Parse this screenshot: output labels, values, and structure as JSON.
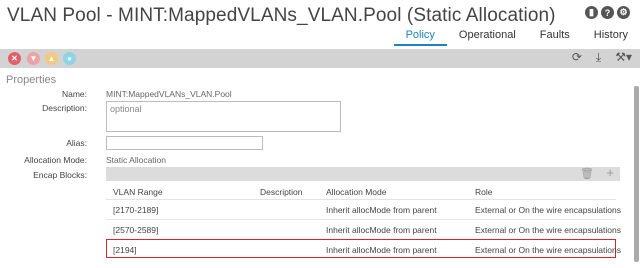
{
  "header": {
    "title": "VLAN Pool - MINT:MappedVLANs_VLAN.Pool (Static Allocation)",
    "icons": [
      "bookmark-icon",
      "help-icon",
      "settings-icon"
    ]
  },
  "tabs": [
    {
      "label": "Policy",
      "active": true
    },
    {
      "label": "Operational",
      "active": false
    },
    {
      "label": "Faults",
      "active": false
    },
    {
      "label": "History",
      "active": false
    }
  ],
  "toolbar": {
    "fault_dots": [
      {
        "icon": "critical-fault-icon",
        "color": "#e2606a"
      },
      {
        "icon": "major-fault-icon",
        "color": "#eda2a7"
      },
      {
        "icon": "minor-fault-icon",
        "color": "#f2c980"
      },
      {
        "icon": "warning-fault-icon",
        "color": "#8ed3e8"
      }
    ],
    "actions": [
      "refresh-icon",
      "download-icon",
      "tools-icon"
    ]
  },
  "properties": {
    "section_title": "Properties",
    "name_label": "Name:",
    "name_value": "MINT:MappedVLANs_VLAN.Pool",
    "description_label": "Description:",
    "description_placeholder": "optional",
    "alias_label": "Alias:",
    "alias_value": "",
    "allocation_label": "Allocation Mode:",
    "allocation_value": "Static Allocation",
    "encap_label": "Encap Blocks:"
  },
  "encap_table": {
    "columns": [
      "VLAN Range",
      "Description",
      "Allocation Mode",
      "Role"
    ],
    "rows": [
      {
        "range": "[2170-2189]",
        "description": "",
        "mode": "Inherit allocMode from parent",
        "role": "External or On the wire encapsulations",
        "selected": false
      },
      {
        "range": "[2570-2589]",
        "description": "",
        "mode": "Inherit allocMode from parent",
        "role": "External or On the wire encapsulations",
        "selected": false
      },
      {
        "range": "[2194]",
        "description": "",
        "mode": "Inherit allocMode from parent",
        "role": "External or On the wire encapsulations",
        "selected": true
      }
    ]
  }
}
